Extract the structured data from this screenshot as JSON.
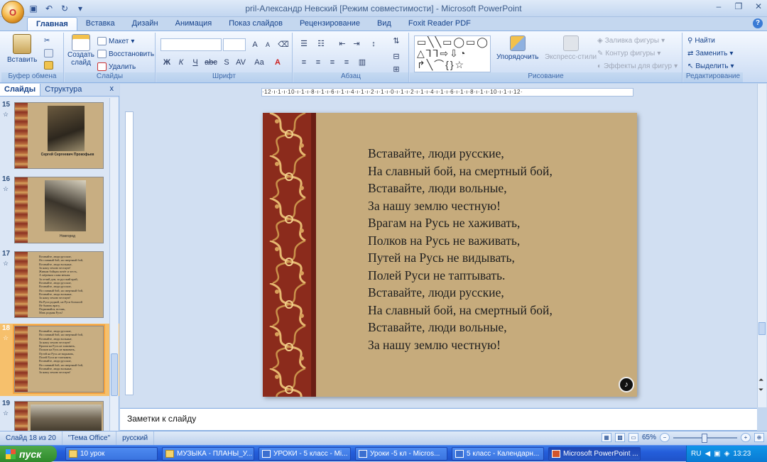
{
  "window": {
    "title": "pril-Александр Невский [Режим совместимости] - Microsoft PowerPoint",
    "office_button": "O"
  },
  "tabs": [
    "Главная",
    "Вставка",
    "Дизайн",
    "Анимация",
    "Показ слайдов",
    "Рецензирование",
    "Вид",
    "Foxit Reader PDF"
  ],
  "ribbon": {
    "clipboard": {
      "label": "Буфер обмена",
      "paste": "Вставить"
    },
    "slides": {
      "label": "Слайды",
      "new_slide_line1": "Создать",
      "new_slide_line2": "слайд",
      "layout": "Макет",
      "reset": "Восстановить",
      "delete": "Удалить"
    },
    "font": {
      "label": "Шрифт",
      "bold": "Ж",
      "italic": "К",
      "underline": "Ч",
      "strike": "abc",
      "shadow": "S",
      "spacing": "AV",
      "case": "Aa",
      "grow": "A",
      "shrink": "A"
    },
    "paragraph": {
      "label": "Абзац"
    },
    "drawing": {
      "label": "Рисование",
      "arrange": "Упорядочить",
      "quick_styles": "Экспресс-стили",
      "fill": "Заливка фигуры",
      "outline": "Контур фигуры",
      "effects": "Эффекты для фигур"
    },
    "editing": {
      "label": "Редактирование",
      "find": "Найти",
      "replace": "Заменить",
      "select": "Выделить"
    }
  },
  "left_panel": {
    "tabs": [
      "Слайды",
      "Структура"
    ],
    "close": "x",
    "thumbnails": [
      {
        "number": "15",
        "caption": "Сергей Сергеевич Прокофьев"
      },
      {
        "number": "16",
        "caption": "Новгород"
      },
      {
        "number": "17",
        "text": "Вставайте, люди русские,\nНа славный бой, на смертный бой,\nВставайте, люди вольные,\nЗа нашу землю честную!\nЖивым бойцам почёт и честь,\nА мёртвым слава вечная\nЗа отчий дом, за русский край,\nВставайте, люди русские,\nВставайте, люди русские,\nНа славный бой, на смертный бой,\nВставайте, люди вольные,\nЗа нашу землю честную!\nНа Руси родной, на Руси большой\nНе бывать врагу,\nПоднимайся, встань,\nМать родная Русь!"
      },
      {
        "number": "18",
        "text": "Вставайте, люди русские,\nНа славный бой, на смертный бой,\nВставайте, люди вольные,\nЗа нашу землю честную!\nВрагам на Русь не хаживать,\nПолков на Русь не важивать,\nПутей на Русь не видывать,\nПолей Руси не таптывать.\nВставайте, люди русские,\nНа славный бой, на смертный бой,\nВставайте, люди вольные,\nЗа нашу землю честную!"
      },
      {
        "number": "19",
        "caption": ""
      }
    ]
  },
  "slide": {
    "lines": "Вставайте, люди русские,\nНа славный бой, на смертный бой,\nВставайте, люди вольные,\nЗа нашу землю честную!\nВрагам на Русь не хаживать,\nПолков на Русь не важивать,\nПутей на Русь не видывать,\nПолей Руси не таптывать.\nВставайте, люди русские,\nНа славный бой, на смертный бой,\nВставайте, люди вольные,\nЗа нашу землю честную!"
  },
  "rulers": {
    "horizontal": "·12·ı·1·ı·10·ı·1·ı·8·ı·1·ı·6·ı·1·ı·4·ı·1·ı·2·ı·1·ı·0·ı·1·ı·2·ı·1·ı·4·ı·1·ı·6·ı·1·ı·8·ı·1·ı·10·ı·1·ı·12·"
  },
  "notes": {
    "placeholder": "Заметки к слайду"
  },
  "status": {
    "slide": "Слайд 18 из 20",
    "theme": "\"Тема Office\"",
    "language": "русский",
    "zoom": "65%"
  },
  "taskbar": {
    "start": "пуск",
    "tasks": [
      "10 урок",
      "МУЗЫКА - ПЛАНЫ_У...",
      "УРОКИ - 5 класс - Mi...",
      "Уроки -5 кл - Micros...",
      "5 класс - Календарн...",
      "Microsoft PowerPoint ..."
    ],
    "lang": "RU",
    "clock": "13:23"
  },
  "colors": {
    "accent": "#15428b",
    "slide_bg": "#c6ab7c",
    "strip": "#8b2b1c"
  }
}
